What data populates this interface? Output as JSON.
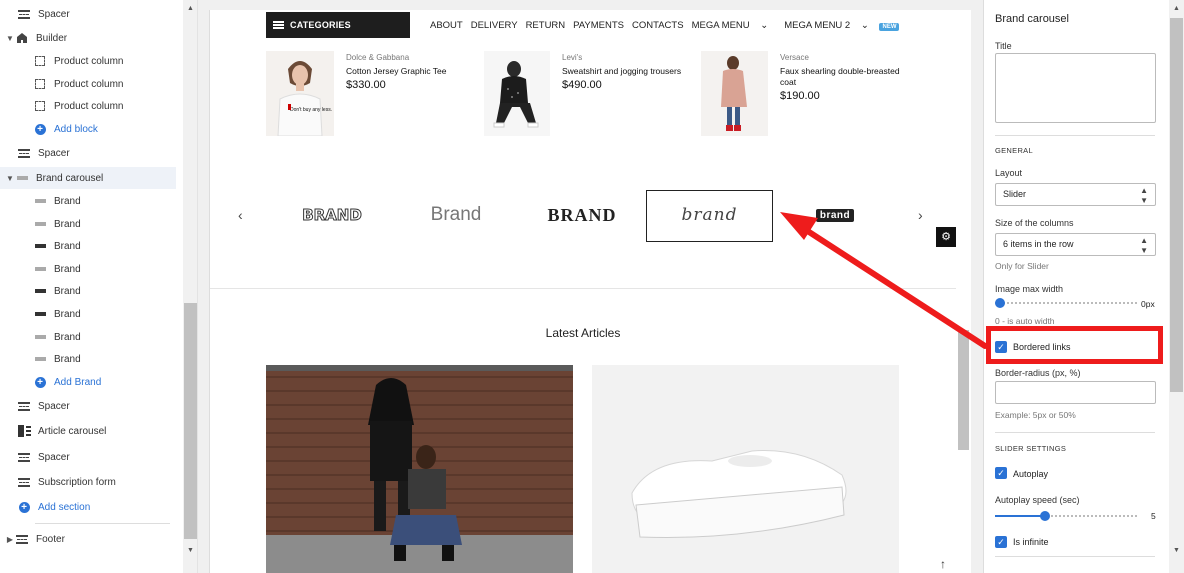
{
  "left_tree": {
    "items": [
      {
        "label": "Spacer",
        "icon": "spacer-icon"
      },
      {
        "label": "Builder",
        "icon": "home-icon"
      },
      {
        "label": "Product column",
        "icon": "column-icon"
      },
      {
        "label": "Product column",
        "icon": "column-icon"
      },
      {
        "label": "Product column",
        "icon": "column-icon"
      },
      {
        "label": "Add block",
        "icon": "plus-circle-icon"
      },
      {
        "label": "Spacer",
        "icon": "spacer-icon"
      },
      {
        "label": "Brand carousel",
        "icon": "brand-carousel-icon"
      },
      {
        "label": "Brand",
        "icon": "brand-thumb-icon"
      },
      {
        "label": "Brand",
        "icon": "brand-thumb-icon"
      },
      {
        "label": "Brand",
        "icon": "brand-thumb-icon"
      },
      {
        "label": "Brand",
        "icon": "brand-thumb-icon"
      },
      {
        "label": "Brand",
        "icon": "brand-thumb-icon"
      },
      {
        "label": "Brand",
        "icon": "brand-thumb-icon"
      },
      {
        "label": "Brand",
        "icon": "brand-thumb-icon"
      },
      {
        "label": "Brand",
        "icon": "brand-thumb-icon"
      },
      {
        "label": "Add Brand",
        "icon": "plus-circle-icon"
      },
      {
        "label": "Spacer",
        "icon": "spacer-icon"
      },
      {
        "label": "Article carousel",
        "icon": "article-icon"
      },
      {
        "label": "Spacer",
        "icon": "spacer-icon"
      },
      {
        "label": "Subscription form",
        "icon": "spacer-icon"
      },
      {
        "label": "Add section",
        "icon": "plus-circle-icon"
      },
      {
        "label": "Footer",
        "icon": "spacer-icon"
      }
    ]
  },
  "nav": {
    "categories": "CATEGORIES",
    "menu": [
      "ABOUT",
      "DELIVERY",
      "RETURN",
      "PAYMENTS",
      "CONTACTS"
    ],
    "mega1": "MEGA MENU",
    "mega2": "MEGA MENU 2",
    "new_badge": "NEW"
  },
  "products": [
    {
      "brand": "Dolce & Gabbana",
      "title": "Cotton Jersey Graphic Tee",
      "price": "$330.00",
      "shirt_text": "Don't buy any less."
    },
    {
      "brand": "Levi's",
      "title": "Sweatshirt and jogging trousers",
      "price": "$490.00"
    },
    {
      "brand": "Versace",
      "title": "Faux shearling double-breasted coat",
      "price": "$190.00"
    }
  ],
  "brands": {
    "items": [
      "BRAND",
      "Brand",
      "BRAND",
      "brand",
      "brand"
    ],
    "prev": "‹",
    "next": "›"
  },
  "latest_articles": "Latest Articles",
  "settings": {
    "title": "Brand carousel",
    "title_label": "Title",
    "general": "GENERAL",
    "layout_label": "Layout",
    "layout_value": "Slider",
    "columns_label": "Size of the columns",
    "columns_value": "6 items in the row",
    "columns_hint": "Only for Slider",
    "image_max_width_label": "Image max width",
    "image_max_width_value": "0px",
    "image_max_width_hint": "0 - is auto width",
    "bordered_links_label": "Bordered links",
    "bordered_links_checked": true,
    "border_radius_label": "Border-radius (px, %)",
    "border_radius_hint": "Example: 5px or 50%",
    "slider_settings": "SLIDER SETTINGS",
    "autoplay_label": "Autoplay",
    "autoplay_speed_label": "Autoplay speed (sec)",
    "autoplay_speed_value": "5",
    "autoplay_speed_fraction": 0.35,
    "is_infinite_label": "Is infinite"
  },
  "colors": {
    "accent": "#2a72d5",
    "annotation": "#ee1c1c"
  }
}
